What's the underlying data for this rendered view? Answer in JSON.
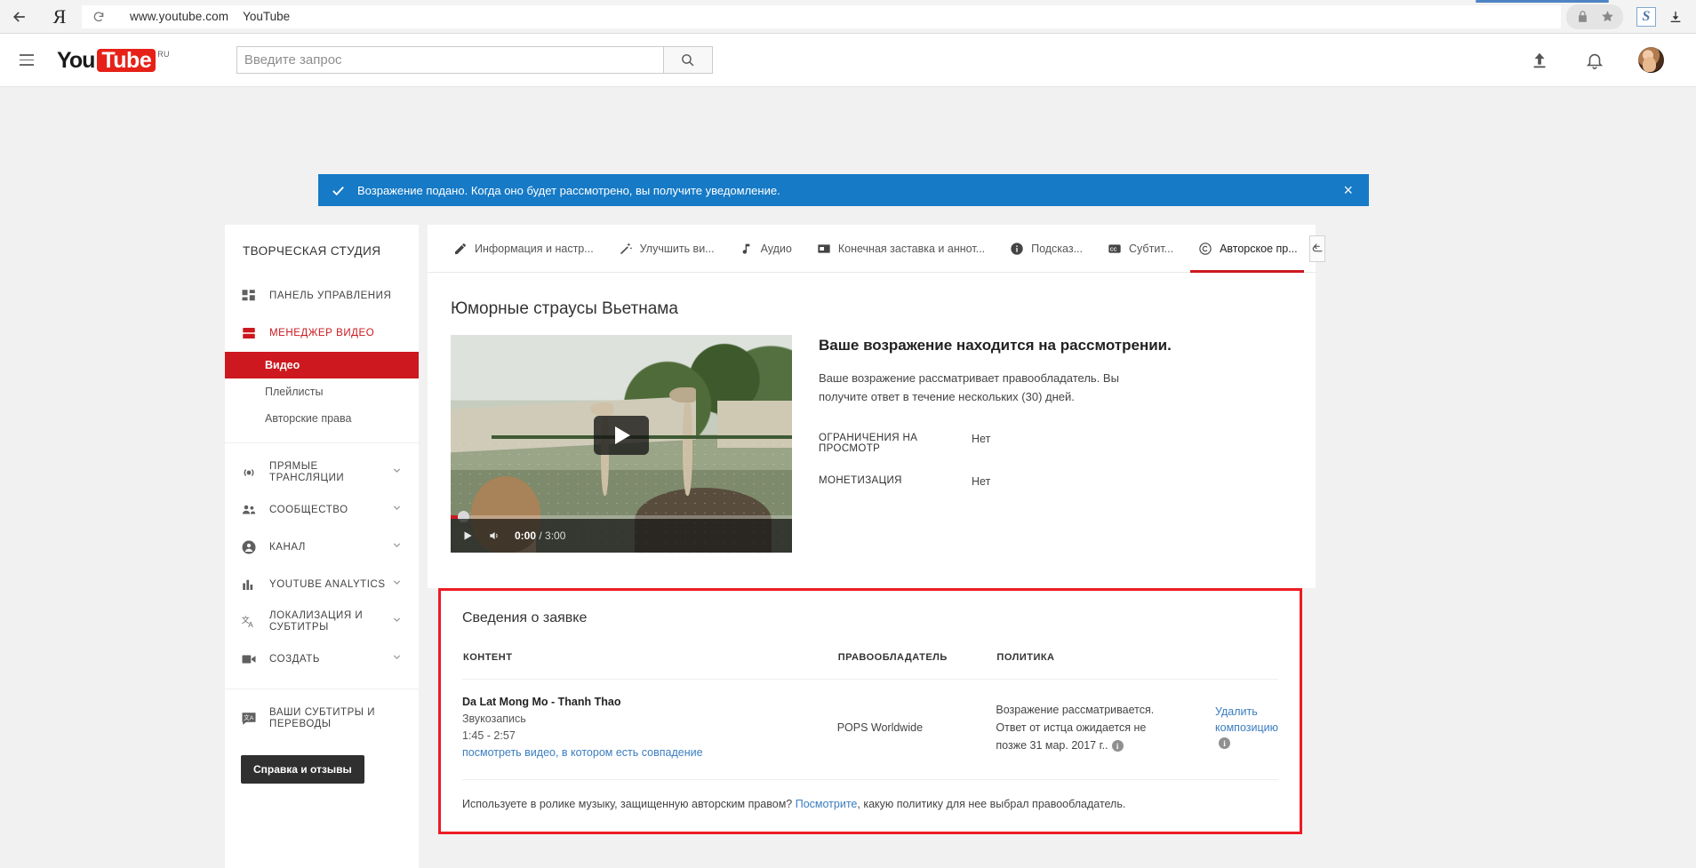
{
  "browser": {
    "back_icon": "back-arrow-icon",
    "brand": "Я",
    "reload_icon": "reload-icon",
    "url": "www.youtube.com",
    "page_title": "YouTube",
    "lock_icon": "lock-icon",
    "star_icon": "star-icon",
    "extension_label": "S",
    "download_icon": "download-icon"
  },
  "masthead": {
    "menu_icon": "hamburger-menu-icon",
    "logo_you": "You",
    "logo_tube": "Tube",
    "logo_country": "RU",
    "search_placeholder": "Введите запрос",
    "search_value": "",
    "search_icon": "search-icon",
    "upload_icon": "upload-icon",
    "notifications_icon": "bell-icon",
    "avatar": "user-avatar"
  },
  "banner": {
    "icon": "checkmark-icon",
    "text": "Возражение подано. Когда оно будет рассмотрено, вы получите уведомление.",
    "close": "×"
  },
  "sidebar": {
    "title": "ТВОРЧЕСКАЯ СТУДИЯ",
    "items": [
      {
        "label": "ПАНЕЛЬ УПРАВЛЕНИЯ",
        "icon": "dashboard-icon",
        "caret": false,
        "active": false
      },
      {
        "label": "МЕНЕДЖЕР ВИДЕО",
        "icon": "video-manager-icon",
        "caret": false,
        "active": true
      }
    ],
    "sub_items": [
      {
        "label": "Видео",
        "selected": true
      },
      {
        "label": "Плейлисты",
        "selected": false
      },
      {
        "label": "Авторские права",
        "selected": false
      }
    ],
    "groups": [
      {
        "label": "ПРЯМЫЕ ТРАНСЛЯЦИИ",
        "icon": "live-stream-icon"
      },
      {
        "label": "СООБЩЕСТВО",
        "icon": "community-icon"
      },
      {
        "label": "КАНАЛ",
        "icon": "channel-icon"
      },
      {
        "label": "YOUTUBE ANALYTICS",
        "icon": "analytics-icon"
      },
      {
        "label": "ЛОКАЛИЗАЦИЯ И СУБТИТРЫ",
        "icon": "translate-icon"
      },
      {
        "label": "СОЗДАТЬ",
        "icon": "camera-icon"
      }
    ],
    "footer_item": {
      "label": "ВАШИ СУБТИТРЫ И ПЕРЕВОДЫ",
      "icon": "translate-icon"
    },
    "help_button": "Справка и отзывы"
  },
  "tabs": [
    {
      "label": "Информация и настр...",
      "icon": "pencil-icon",
      "active": false
    },
    {
      "label": "Улучшить ви...",
      "icon": "magic-wand-icon",
      "active": false
    },
    {
      "label": "Аудио",
      "icon": "music-note-icon",
      "active": false
    },
    {
      "label": "Конечная заставка и аннот...",
      "icon": "end-screen-icon",
      "active": false
    },
    {
      "label": "Подсказ...",
      "icon": "info-icon",
      "active": false
    },
    {
      "label": "Субтит...",
      "icon": "cc-icon",
      "active": false
    },
    {
      "label": "Авторское пр...",
      "icon": "copyright-icon",
      "active": true
    }
  ],
  "back_button_icon": "back-arrow-icon",
  "video": {
    "title": "Юморные страусы Вьетнама",
    "play_icon": "play-icon",
    "volume_icon": "volume-icon",
    "current_time": "0:00",
    "separator": " / ",
    "duration": "3:00"
  },
  "status": {
    "heading": "Ваше возражение находится на рассмотрении.",
    "description": "Ваше возражение рассматривает правообладатель. Вы получите ответ в течение нескольких (30) дней.",
    "fields": [
      {
        "key": "ОГРАНИЧЕНИЯ НА ПРОСМОТР",
        "value": "Нет"
      },
      {
        "key": "МОНЕТИЗАЦИЯ",
        "value": "Нет"
      }
    ]
  },
  "claim": {
    "heading": "Сведения о заявке",
    "highlight_color": "#ec1c24",
    "columns": [
      "КОНТЕНТ",
      "ПРАВООБЛАДАТЕЛЬ",
      "ПОЛИТИКА"
    ],
    "row": {
      "content_title": "Da Lat Mong Mo - Thanh Thao",
      "content_type": "Звукозапись",
      "content_time": "1:45 - 2:57",
      "content_link": "посмотреть видео, в котором есть совпадение",
      "owner": "POPS Worldwide",
      "policy_line1": "Возражение рассматривается.",
      "policy_line2": "Ответ от истца ожидается не",
      "policy_line3": "позже 31 мар. 2017 г..",
      "policy_info_icon": "info-icon",
      "action_link": "Удалить композицию",
      "action_info_icon": "info-icon"
    },
    "note_before": "Используете в ролике музыку, защищенную авторским правом? ",
    "note_link": "Посмотрите",
    "note_after": ", какую политику для нее выбрал правообладатель."
  }
}
